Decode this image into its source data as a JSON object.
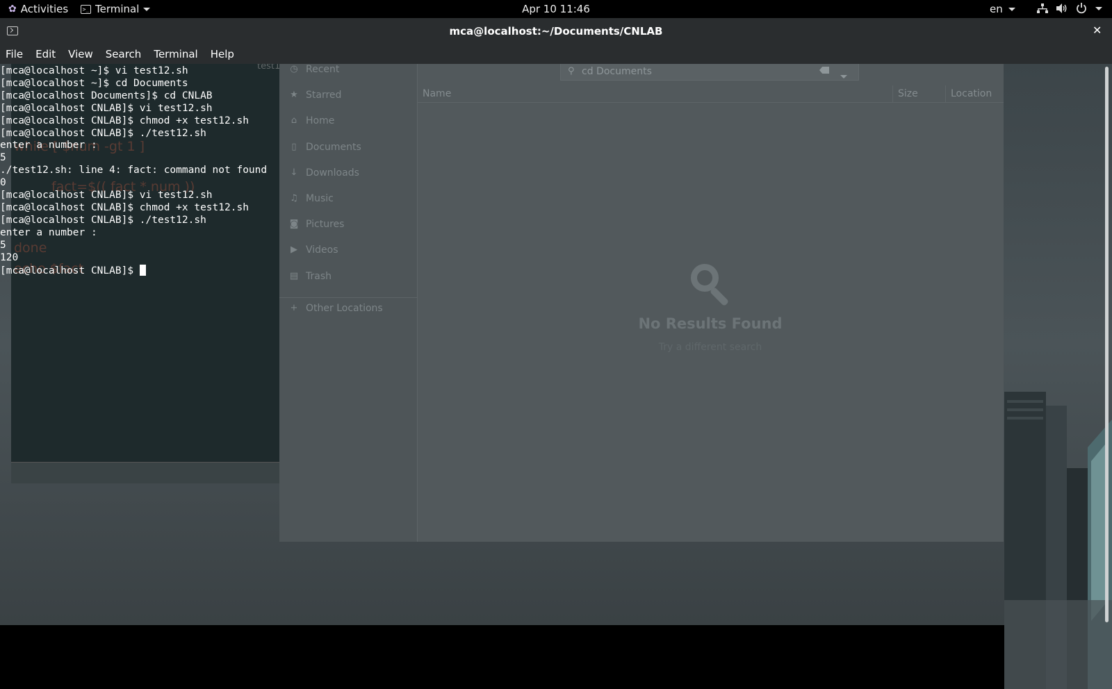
{
  "topbar": {
    "activities": "Activities",
    "app_name": "Terminal",
    "clock": "Apr 10  11:46",
    "lang": "en"
  },
  "window": {
    "title": "mca@localhost:~/Documents/CNLAB",
    "close": "✕"
  },
  "menu": [
    "File",
    "Edit",
    "View",
    "Search",
    "Terminal",
    "Help"
  ],
  "terminal": {
    "lines": [
      "[mca@localhost ~]$ vi test12.sh",
      "[mca@localhost ~]$ cd Documents",
      "[mca@localhost Documents]$ cd CNLAB",
      "[mca@localhost CNLAB]$ vi test12.sh",
      "[mca@localhost CNLAB]$ chmod +x test12.sh",
      "[mca@localhost CNLAB]$ ./test12.sh",
      "enter a number :",
      "5",
      "./test12.sh: line 4: fact: command not found",
      "0",
      "[mca@localhost CNLAB]$ vi test12.sh",
      "[mca@localhost CNLAB]$ chmod +x test12.sh",
      "[mca@localhost CNLAB]$ ./test12.sh",
      "enter a number :",
      "5",
      "120"
    ],
    "prompt": "[mca@localhost CNLAB]$ "
  },
  "background_code": {
    "while": "while [ $num -gt 1 ]",
    "fact": "fact=$(( fact * num ))",
    "done": "done",
    "echo": "echo $fact",
    "tab": "test1"
  },
  "files": {
    "sidebar": [
      {
        "label": "Recent",
        "icon": "clock-icon"
      },
      {
        "label": "Starred",
        "icon": "star-icon"
      },
      {
        "label": "Home",
        "icon": "home-icon"
      },
      {
        "label": "Documents",
        "icon": "document-icon"
      },
      {
        "label": "Downloads",
        "icon": "download-icon"
      },
      {
        "label": "Music",
        "icon": "music-icon"
      },
      {
        "label": "Pictures",
        "icon": "camera-icon"
      },
      {
        "label": "Videos",
        "icon": "video-icon"
      },
      {
        "label": "Trash",
        "icon": "trash-icon"
      }
    ],
    "other_locations": "Other Locations",
    "search_text": "cd Documents",
    "columns": {
      "name": "Name",
      "size": "Size",
      "location": "Location"
    },
    "empty_title": "No Results Found",
    "empty_sub": "Try a different search"
  }
}
